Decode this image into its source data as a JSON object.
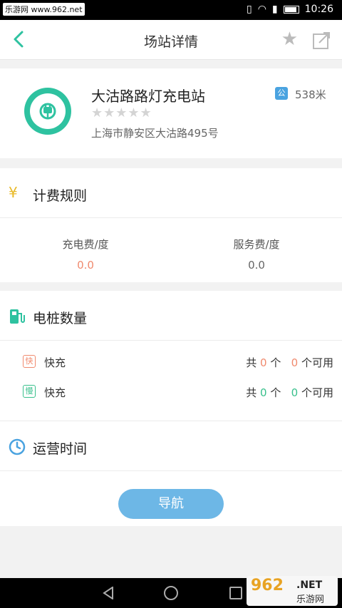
{
  "status_bar": {
    "watermark": "乐游网 www.962.net",
    "time": "10:26"
  },
  "header": {
    "title": "场站详情"
  },
  "station": {
    "name": "大沽路路灯充电站",
    "public_badge": "公",
    "distance": "538米",
    "rating_stars": "★★★★★",
    "address": "上海市静安区大沽路495号"
  },
  "fee": {
    "section_title": "计费规则",
    "charge_label": "充电费/度",
    "charge_value": "0.0",
    "service_label": "服务费/度",
    "service_value": "0.0"
  },
  "piles": {
    "section_title": "电桩数量",
    "rows": [
      {
        "tag": "快",
        "name": "快充",
        "total_prefix": "共",
        "total": "0",
        "unit1": "个",
        "available": "0",
        "suffix": "个可用",
        "color": "#f08a6e"
      },
      {
        "tag": "慢",
        "name": "快充",
        "total_prefix": "共",
        "total": "0",
        "unit1": "个",
        "available": "0",
        "suffix": "个可用",
        "color": "#39c08c"
      }
    ]
  },
  "hours": {
    "section_title": "运营时间"
  },
  "nav_button": "导航",
  "brand_logo": {
    "number": "962",
    "domain": ".NET",
    "cn": "乐游网"
  },
  "colors": {
    "accent_green": "#2ec2a0",
    "button_blue": "#6db7e6",
    "fee_orange": "#f08a6e"
  }
}
